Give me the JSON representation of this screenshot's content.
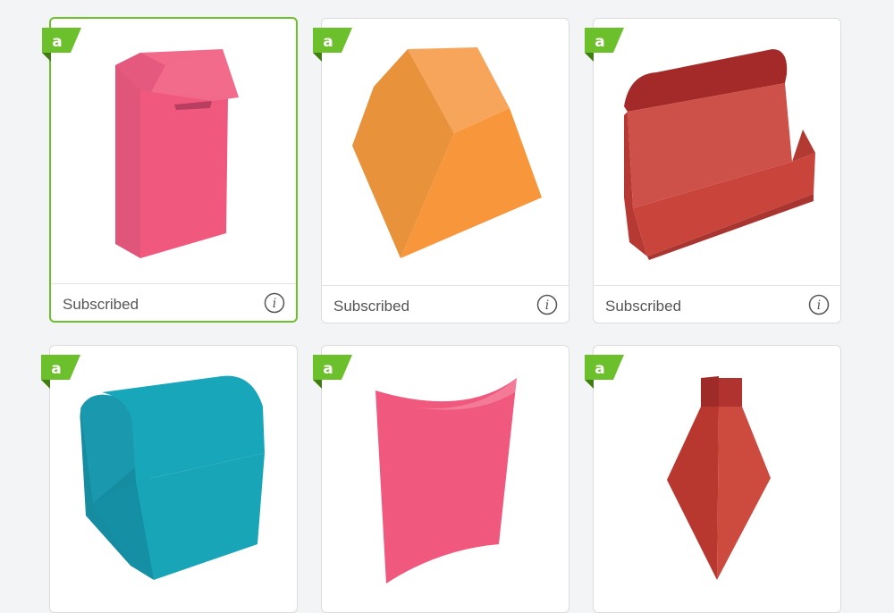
{
  "colors": {
    "accent_green": "#6cc02b",
    "card_border": "#dcdcdc",
    "background": "#f3f4f5"
  },
  "badge": {
    "letter": "a",
    "icon": "access-badge-icon"
  },
  "cards": [
    {
      "status": "Subscribed",
      "shape": "pink tall box with flap lid",
      "selected": true
    },
    {
      "status": "Subscribed",
      "shape": "orange trapezoid box",
      "selected": false
    },
    {
      "status": "Subscribed",
      "shape": "red open display box",
      "selected": false
    },
    {
      "status": "",
      "shape": "teal treasure chest box",
      "selected": false
    },
    {
      "status": "",
      "shape": "pink pillow box",
      "selected": false
    },
    {
      "status": "",
      "shape": "red diamond tie box",
      "selected": false
    }
  ]
}
